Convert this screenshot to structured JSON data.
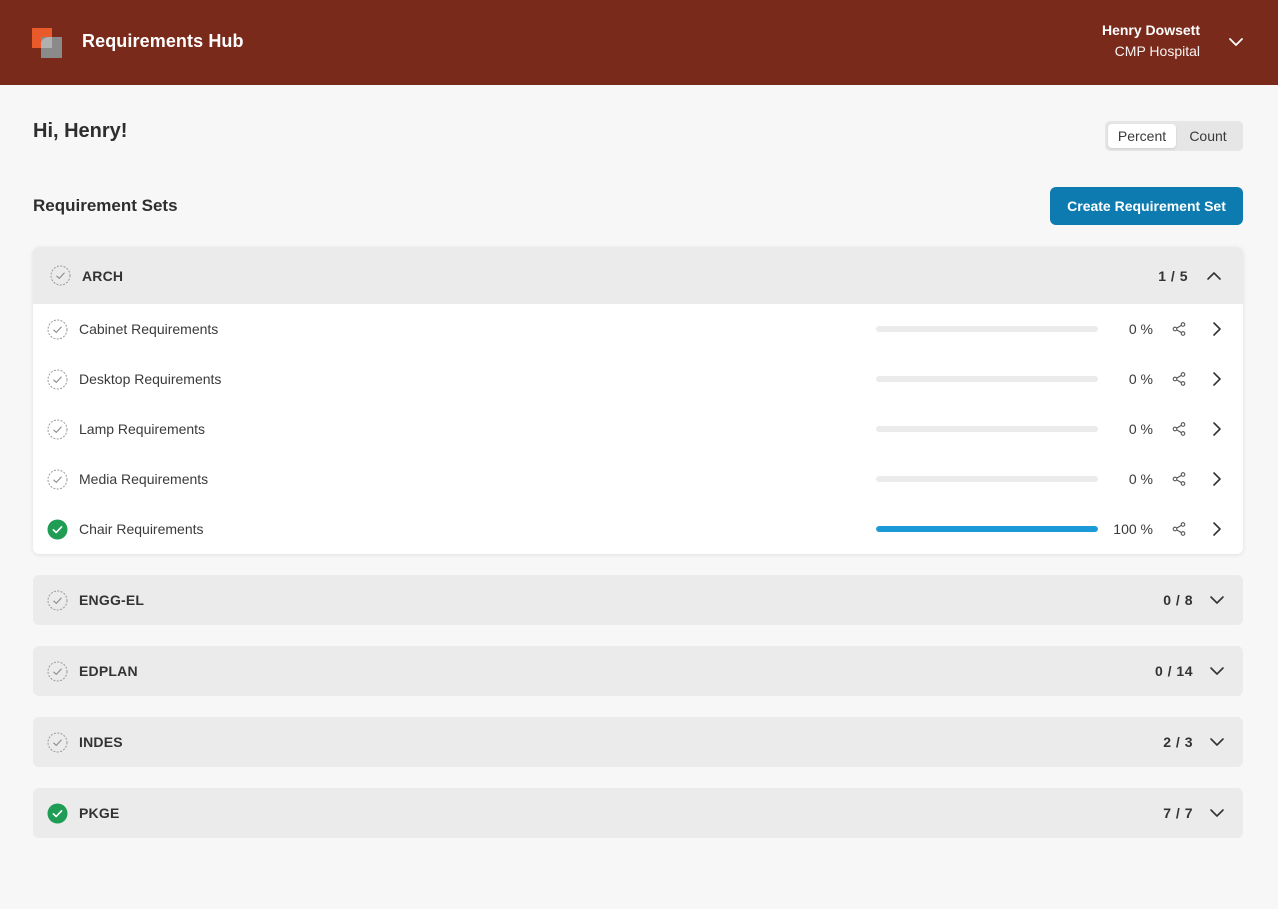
{
  "header": {
    "app_title": "Requirements Hub",
    "user_name": "Henry Dowsett",
    "user_org": "CMP Hospital",
    "logo_icon": "hub-logo-icon",
    "menu_icon": "chevron-down-icon"
  },
  "greeting": "Hi, Henry!",
  "view_toggle": {
    "options": [
      "Percent",
      "Count"
    ],
    "selected": "Percent"
  },
  "section": {
    "title": "Requirement Sets",
    "create_label": "Create Requirement Set"
  },
  "colors": {
    "header_bg": "#7a2a1a",
    "accent": "#0d7bb0",
    "progress": "#1a9ad6",
    "complete": "#1f9d55"
  },
  "groups": [
    {
      "name": "ARCH",
      "count": "1 / 5",
      "expanded": true,
      "complete": false,
      "items": [
        {
          "name": "Cabinet Requirements",
          "percent_label": "0 %",
          "progress": 0,
          "complete": false
        },
        {
          "name": "Desktop Requirements",
          "percent_label": "0 %",
          "progress": 0,
          "complete": false
        },
        {
          "name": "Lamp Requirements",
          "percent_label": "0 %",
          "progress": 0,
          "complete": false
        },
        {
          "name": "Media Requirements",
          "percent_label": "0 %",
          "progress": 0,
          "complete": false
        },
        {
          "name": "Chair Requirements",
          "percent_label": "100 %",
          "progress": 100,
          "complete": true
        }
      ]
    },
    {
      "name": "ENGG-EL",
      "count": "0 / 8",
      "expanded": false,
      "complete": false
    },
    {
      "name": "EDPLAN",
      "count": "0 / 14",
      "expanded": false,
      "complete": false
    },
    {
      "name": "INDES",
      "count": "2 / 3",
      "expanded": false,
      "complete": false
    },
    {
      "name": "PKGE",
      "count": "7 / 7",
      "expanded": false,
      "complete": true
    }
  ]
}
